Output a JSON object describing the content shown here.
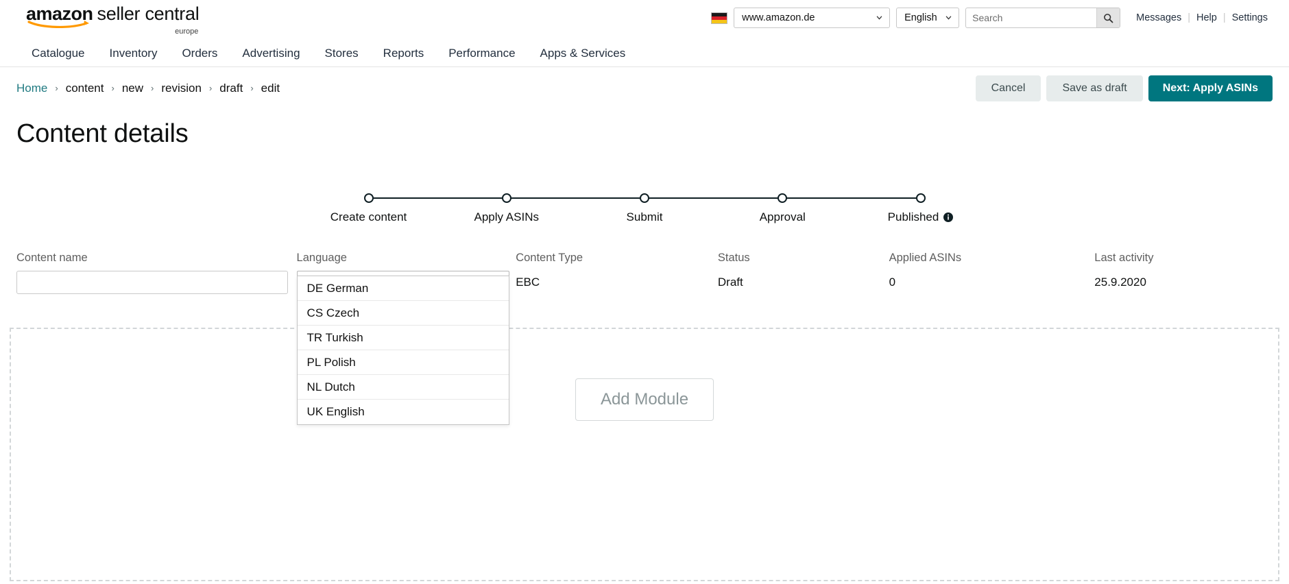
{
  "brand": {
    "amazon": "amazon",
    "seller_central": "seller central",
    "region": "europe"
  },
  "topbar": {
    "flag_icon": "german-flag-icon",
    "store": "www.amazon.de",
    "language": "English",
    "search_placeholder": "Search",
    "search_value": "",
    "search_icon": "search-icon",
    "links": [
      "Messages",
      "Help",
      "Settings"
    ],
    "separator": "|"
  },
  "nav": {
    "items": [
      "Catalogue",
      "Inventory",
      "Orders",
      "Advertising",
      "Stores",
      "Reports",
      "Performance",
      "Apps & Services"
    ]
  },
  "breadcrumb": {
    "home": "Home",
    "items": [
      "content",
      "new",
      "revision",
      "draft",
      "edit"
    ],
    "separator": "›"
  },
  "actions": {
    "cancel": "Cancel",
    "save_draft": "Save as draft",
    "next": "Next: Apply ASINs"
  },
  "page": {
    "title": "Content details"
  },
  "stepper": {
    "steps": [
      {
        "label": "Create content"
      },
      {
        "label": "Apply ASINs"
      },
      {
        "label": "Submit"
      },
      {
        "label": "Approval"
      },
      {
        "label": "Published",
        "info_icon": "info-icon"
      }
    ]
  },
  "fields": {
    "content_name": {
      "label": "Content name",
      "value": "",
      "placeholder": ""
    },
    "language": {
      "label": "Language",
      "value": "",
      "caret_icon": "caret-up-icon",
      "open": true,
      "options": [
        "DE German",
        "CS Czech",
        "TR Turkish",
        "PL Polish",
        "NL Dutch",
        "UK English"
      ]
    },
    "content_type": {
      "label": "Content Type",
      "value": "EBC"
    },
    "status": {
      "label": "Status",
      "value": "Draft"
    },
    "applied_asins": {
      "label": "Applied ASINs",
      "value": "0"
    },
    "last_activity": {
      "label": "Last activity",
      "value": "25.9.2020"
    }
  },
  "module_area": {
    "add_module": "Add Module"
  },
  "colors": {
    "accent": "#00767f",
    "link": "#217b82",
    "button_grey": "#e7ecec",
    "text": "#0f1111"
  }
}
